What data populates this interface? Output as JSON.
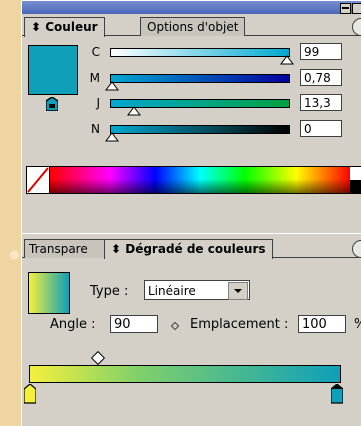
{
  "color_panel": {
    "tabs": [
      {
        "label": "⬍ Couleur"
      },
      {
        "label": "Options d'objet"
      }
    ],
    "fill_color": "#0f9fb9",
    "sliders": [
      {
        "label": "C",
        "value": "99"
      },
      {
        "label": "M",
        "value": "0,78"
      },
      {
        "label": "J",
        "value": "13,3"
      },
      {
        "label": "N",
        "value": "0"
      }
    ]
  },
  "gradient_panel": {
    "tabs": [
      {
        "label": "Transpare"
      },
      {
        "label": "⬍ Dégradé de couleurs"
      }
    ],
    "type_label": "Type :",
    "type_value": "Linéaire",
    "angle_label": "Angle :",
    "angle_value": "90",
    "location_label": "Emplacement :",
    "location_value": "100",
    "start_color": "#f4f03c",
    "end_color": "#0f9fb9"
  }
}
